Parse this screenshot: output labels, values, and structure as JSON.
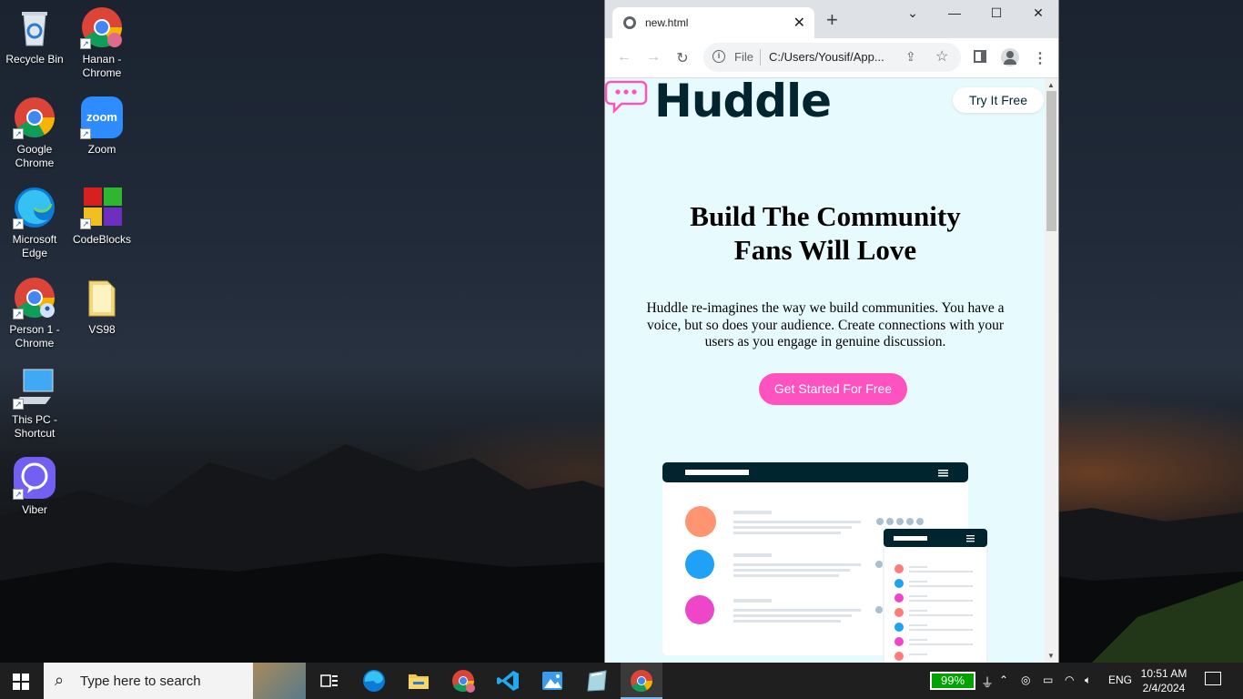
{
  "desktop": {
    "icons": [
      {
        "label": "Recycle Bin"
      },
      {
        "label": "Hanan - Chrome"
      },
      {
        "label": "Google Chrome"
      },
      {
        "label": "Zoom"
      },
      {
        "label": "Microsoft Edge"
      },
      {
        "label": "CodeBlocks"
      },
      {
        "label": "Person 1 - Chrome"
      },
      {
        "label": "VS98"
      },
      {
        "label": "This PC - Shortcut"
      },
      {
        "label": "Viber"
      }
    ],
    "zoom_text": "zoom"
  },
  "browser": {
    "tab_title": "new.html",
    "new_tab_symbol": "+",
    "tab_close_symbol": "✕",
    "address": {
      "scheme_label": "File",
      "url": "C:/Users/Yousif/App..."
    },
    "window_controls": {
      "minimize": "—",
      "maximize": "☐",
      "close": "✕",
      "tab_search": "⌄"
    }
  },
  "page": {
    "logo": "Huddle",
    "try_button": "Try It Free",
    "headline_line1": "Build The Community",
    "headline_line2": "Fans Will Love",
    "description": "Huddle re-imagines the way we build communities. You have a voice, but so does your audience. Create connections with your users as you engage in genuine discussion.",
    "cta_button": "Get Started For Free",
    "brand_colors": {
      "pink": "#ff52c1",
      "dark": "#00252e",
      "background": "#e7fafe"
    }
  },
  "taskbar": {
    "search_placeholder": "Type here to search",
    "battery": "99%",
    "language": "ENG",
    "time": "10:51 AM",
    "date": "2/4/2024"
  }
}
